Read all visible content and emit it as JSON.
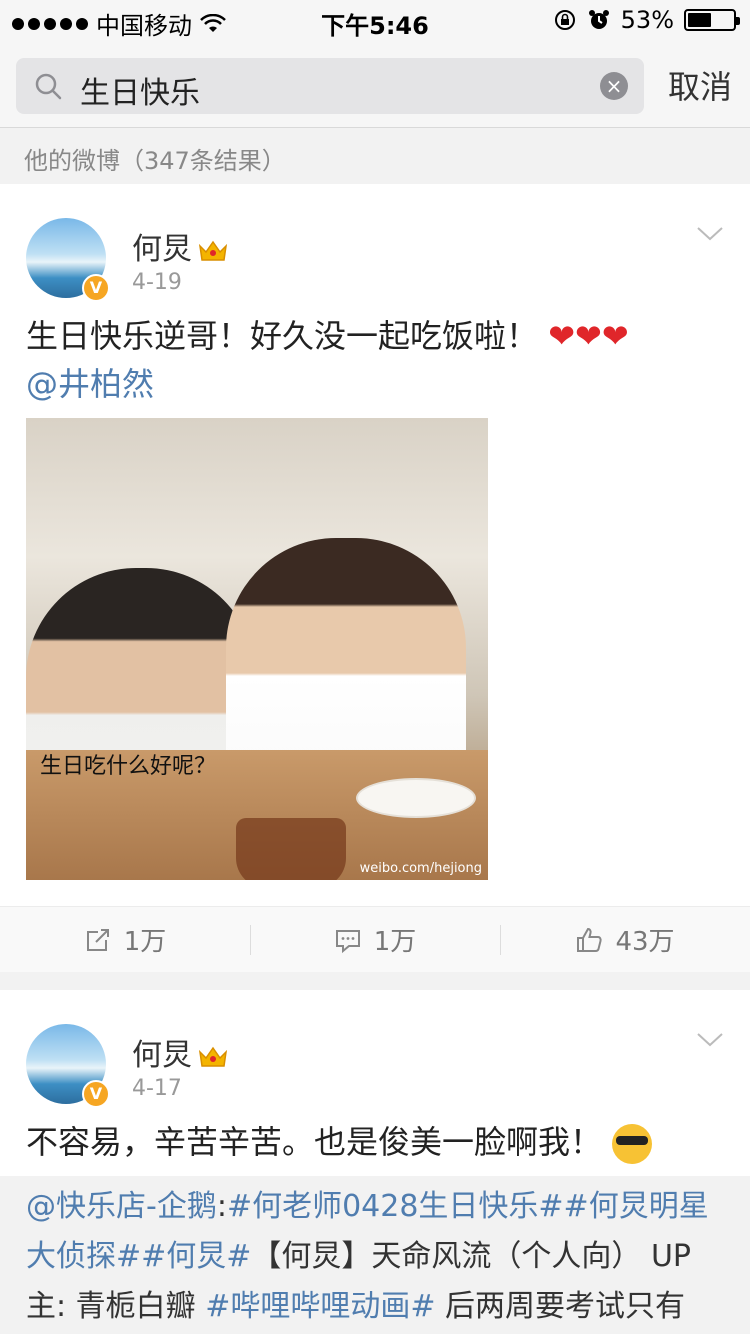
{
  "status_bar": {
    "carrier": "中国移动",
    "time": "下午5:46",
    "battery_pct_text": "53%",
    "battery_level": 0.53
  },
  "search": {
    "query": "生日快乐",
    "cancel_label": "取消"
  },
  "results_header": "他的微博（347条结果）",
  "posts": [
    {
      "username": "何炅",
      "date": "4-19",
      "text": "生日快乐逆哥！好久没一起吃饭啦！",
      "hearts": "❤❤❤",
      "mention": "@井柏然",
      "photo_caption": "生日吃什么好呢？",
      "photo_watermark": "weibo.com/hejiong",
      "repost_count": "1万",
      "comment_count": "1万",
      "like_count": "43万"
    },
    {
      "username": "何炅",
      "date": "4-17",
      "text": "不容易，辛苦辛苦。也是俊美一脸啊我！",
      "repost_mention": "@快乐店-企鹅",
      "repost_colon": ":",
      "repost_tags": "#何老师0428生日快乐##何炅明星大侦探##何炅#",
      "repost_text1": "【何炅】天命风流（个人向） UP主: 青栀白瓣 ",
      "repost_tag2": "#哔哩哔哩动画#",
      "repost_text2": " 后两周要考试只有"
    }
  ],
  "colors": {
    "link": "#507daf",
    "verified_badge": "#f6a623",
    "heart": "#e0262a"
  }
}
